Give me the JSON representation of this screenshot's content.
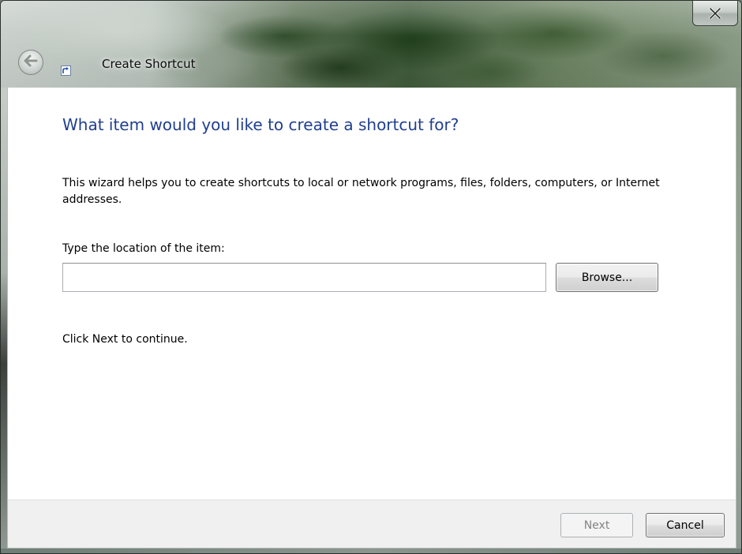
{
  "window": {
    "title": "Create Shortcut",
    "close_glyph": "x",
    "icons": {
      "back": "back-arrow-icon",
      "app": "shortcut-icon",
      "close": "close-icon"
    }
  },
  "wizard": {
    "heading": "What item would you like to create a shortcut for?",
    "description": "This wizard helps you to create shortcuts to local or network programs, files, folders, computers, or Internet addresses.",
    "location_label": "Type the location of the item:",
    "location_value": "",
    "location_placeholder": "",
    "browse_label": "Browse...",
    "continue_text": "Click Next to continue."
  },
  "footer": {
    "next_label": "Next",
    "next_enabled": false,
    "cancel_label": "Cancel"
  },
  "colors": {
    "heading": "#1f3f8f",
    "disabled_text": "#838383",
    "content_bg": "#ffffff",
    "footer_bg": "#f0f0f0"
  }
}
